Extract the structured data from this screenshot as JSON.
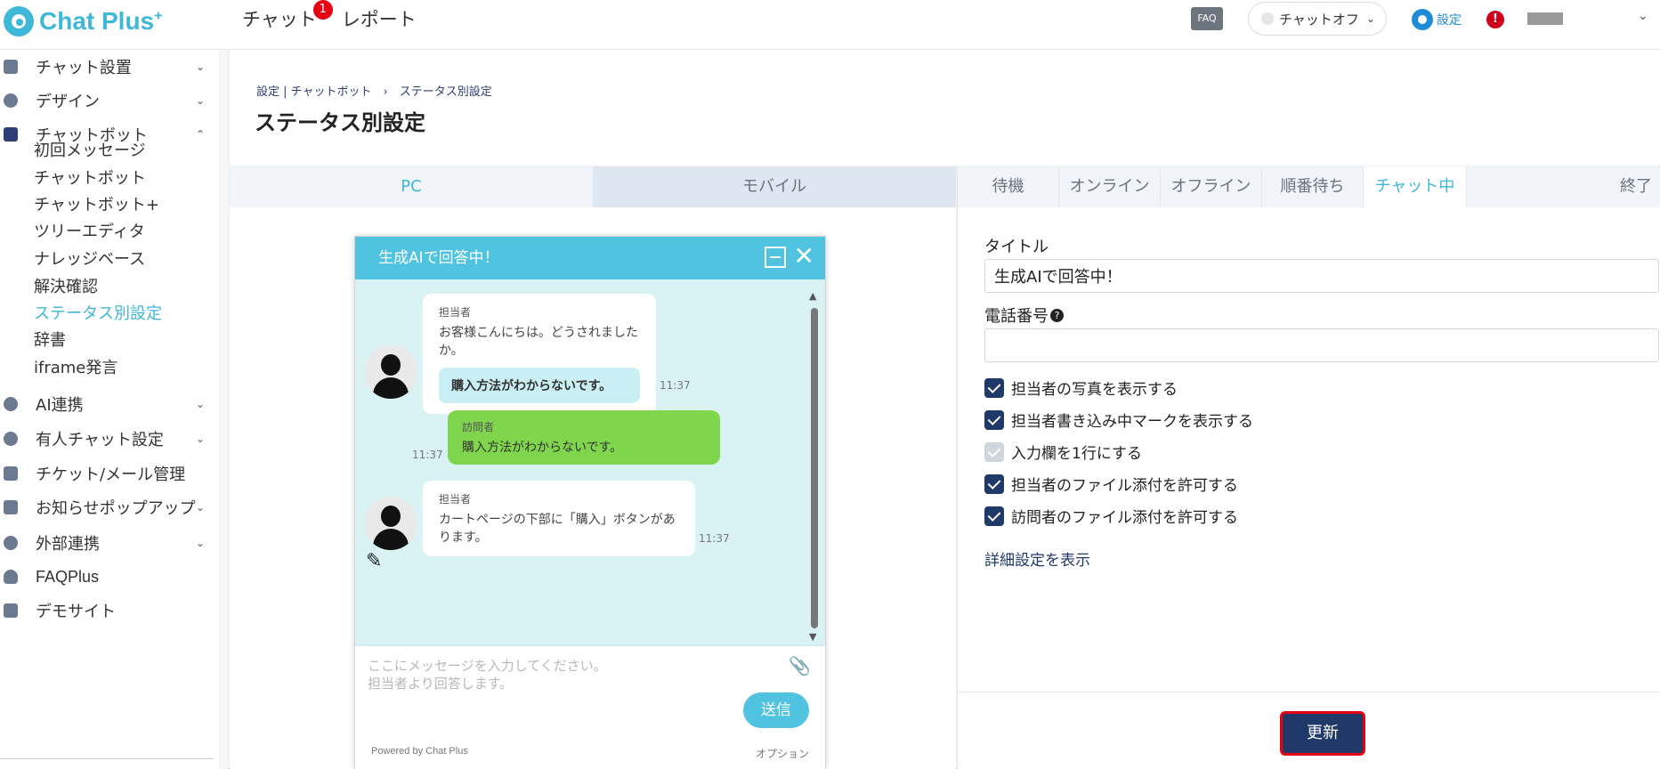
{
  "header": {
    "logo_text": "Chat Plus",
    "logo_plus": "+",
    "nav": [
      {
        "label": "チャット",
        "badge": "1"
      },
      {
        "label": "レポート"
      }
    ],
    "faq_label": "FAQ",
    "status_label": "チャットオフ",
    "settings_label": "設定",
    "alert_symbol": "!"
  },
  "sidebar": {
    "groups": [
      {
        "label": "チャット設置"
      },
      {
        "label": "デザイン"
      },
      {
        "label": "チャットボット"
      }
    ],
    "subitems": [
      {
        "label": "初回メッセージ"
      },
      {
        "label": "チャットボット"
      },
      {
        "label": "チャットボット+"
      },
      {
        "label": "ツリーエディタ"
      },
      {
        "label": "ナレッジベース"
      },
      {
        "label": "解決確認"
      },
      {
        "label": "ステータス別設定",
        "active": true
      },
      {
        "label": "辞書"
      },
      {
        "label": "iframe発言"
      }
    ],
    "groups2": [
      {
        "label": "AI連携"
      },
      {
        "label": "有人チャット設定"
      },
      {
        "label": "チケット/メール管理"
      },
      {
        "label": "お知らせポップアップ"
      },
      {
        "label": "外部連携"
      },
      {
        "label": "FAQPlus"
      },
      {
        "label": "デモサイト"
      }
    ]
  },
  "page": {
    "breadcrumb": "設定 | チャットボット　›　ステータス別設定",
    "title": "ステータス別設定"
  },
  "preview": {
    "tabs": [
      {
        "label": "PC"
      },
      {
        "label": "モバイル"
      }
    ],
    "widget": {
      "title": "生成AIで回答中！",
      "messages": [
        {
          "who": "担当者",
          "text": "お客様こんにちは。どうされましたか。",
          "quick": "購入方法がわからないです。",
          "time": "11:37"
        },
        {
          "who": "訪問者",
          "text": "購入方法がわからないです。",
          "time": "11:37"
        },
        {
          "who": "担当者",
          "text": "カートページの下部に「購入」ボタンがあります。",
          "time": "11:37"
        }
      ],
      "placeholder_line1": "ここにメッセージを入力してください。",
      "placeholder_line2": "担当者より回答します。",
      "send_label": "送信",
      "powered": "Powered by Chat Plus",
      "option": "オプション"
    }
  },
  "settings": {
    "tabs": [
      {
        "label": "待機"
      },
      {
        "label": "オンライン"
      },
      {
        "label": "オフライン"
      },
      {
        "label": "順番待ち"
      },
      {
        "label": "チャット中",
        "active": true
      },
      {
        "label": "終了"
      }
    ],
    "title_label": "タイトル",
    "title_value": "生成AIで回答中！",
    "phone_label": "電話番号",
    "phone_help": "?",
    "phone_value": "",
    "checks": [
      {
        "label": "担当者の写真を表示する",
        "checked": true
      },
      {
        "label": "担当者書き込み中マークを表示する",
        "checked": true
      },
      {
        "label": "入力欄を1行にする",
        "checked": true,
        "disabled": true
      },
      {
        "label": "担当者のファイル添付を許可する",
        "checked": true
      },
      {
        "label": "訪問者のファイル添付を許可する",
        "checked": true
      }
    ],
    "detail_link": "詳細設定を表示",
    "update_label": "更新"
  }
}
